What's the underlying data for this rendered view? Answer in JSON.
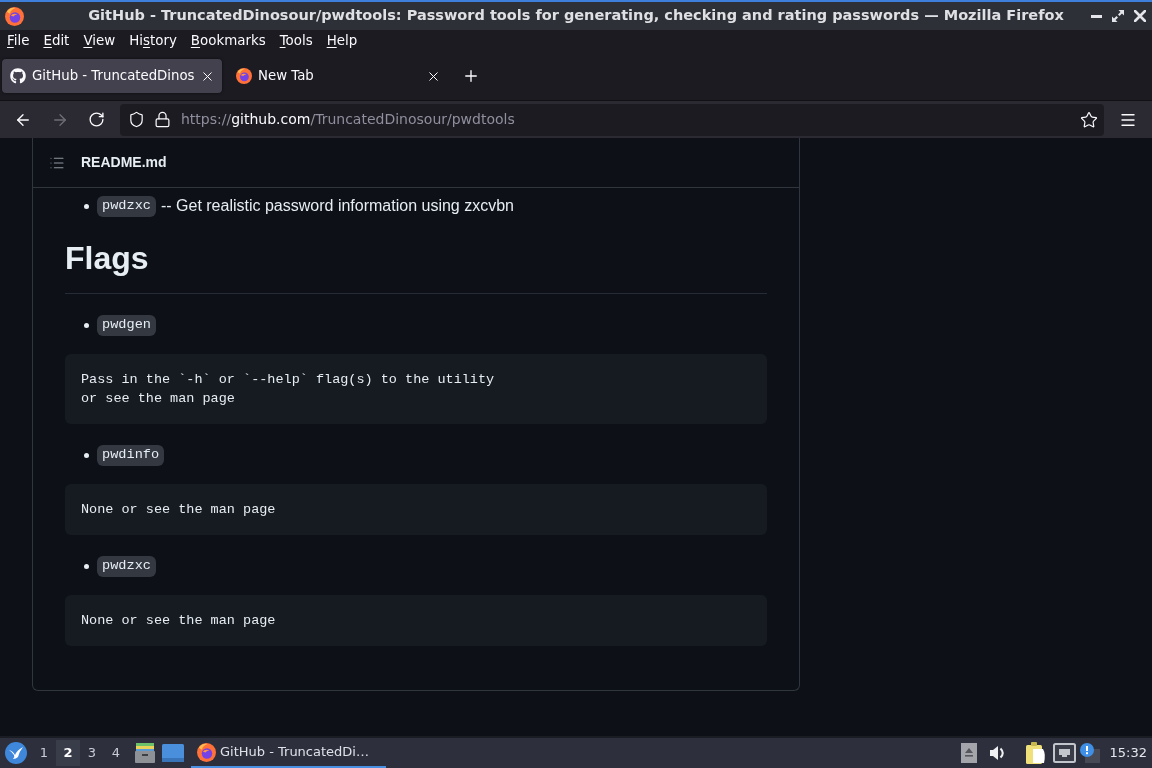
{
  "window": {
    "title": "GitHub - TruncatedDinosour/pwdtools: Password tools for generating, checking and rating passwords — Mozilla Firefox"
  },
  "menu_bar": [
    {
      "label": [
        {
          "text": "F",
          "underlined": true
        },
        {
          "text": "ile",
          "underlined": false
        }
      ]
    },
    {
      "label": [
        {
          "text": "E",
          "underlined": true
        },
        {
          "text": "dit",
          "underlined": false
        }
      ]
    },
    {
      "label": [
        {
          "text": "V",
          "underlined": true
        },
        {
          "text": "iew",
          "underlined": false
        }
      ]
    },
    {
      "label": [
        {
          "text": "Hi",
          "underlined": false
        },
        {
          "text": "s",
          "underlined": true
        },
        {
          "text": "tory",
          "underlined": false
        }
      ]
    },
    {
      "label": [
        {
          "text": "B",
          "underlined": true
        },
        {
          "text": "ookmarks",
          "underlined": false
        }
      ]
    },
    {
      "label": [
        {
          "text": "T",
          "underlined": true
        },
        {
          "text": "ools",
          "underlined": false
        }
      ]
    },
    {
      "label": [
        {
          "text": "H",
          "underlined": true
        },
        {
          "text": "elp",
          "underlined": false
        }
      ]
    }
  ],
  "tabs": [
    {
      "kind": "github",
      "title": "GitHub - TruncatedDinos",
      "selected": true
    },
    {
      "kind": "firefox",
      "title": "New Tab",
      "selected": false
    }
  ],
  "navigation": {
    "back": {
      "disabled": false
    },
    "forward": {
      "disabled": true
    }
  },
  "address_bar": {
    "scheme": "https://",
    "host": "github.com",
    "path": "/TruncatedDinosour/pwdtools"
  },
  "readme": {
    "filename": "README.md",
    "blocks": [
      {
        "kind": "list_item",
        "code": "pwdzxc",
        "text": "-- Get realistic password information using zxcvbn"
      },
      {
        "kind": "heading",
        "text": "Flags"
      },
      {
        "kind": "list_item",
        "code": "pwdgen"
      },
      {
        "kind": "code_block",
        "lines": [
          "Pass in the `-h` or `--help` flag(s) to the utility",
          "or see the man page"
        ]
      },
      {
        "kind": "list_item",
        "code": "pwdinfo"
      },
      {
        "kind": "code_block",
        "lines": [
          "None or see the man page"
        ]
      },
      {
        "kind": "list_item",
        "code": "pwdzxc"
      },
      {
        "kind": "code_block",
        "lines": [
          "None or see the man page"
        ]
      }
    ]
  },
  "taskbar": {
    "workspaces": [
      {
        "label": "1",
        "selected": false
      },
      {
        "label": "2",
        "selected": true
      },
      {
        "label": "3",
        "selected": false
      },
      {
        "label": "4",
        "selected": false
      }
    ],
    "tasks": [
      {
        "title": "GitHub - TruncatedDi…",
        "selected": true
      }
    ],
    "clock": "15:32"
  }
}
